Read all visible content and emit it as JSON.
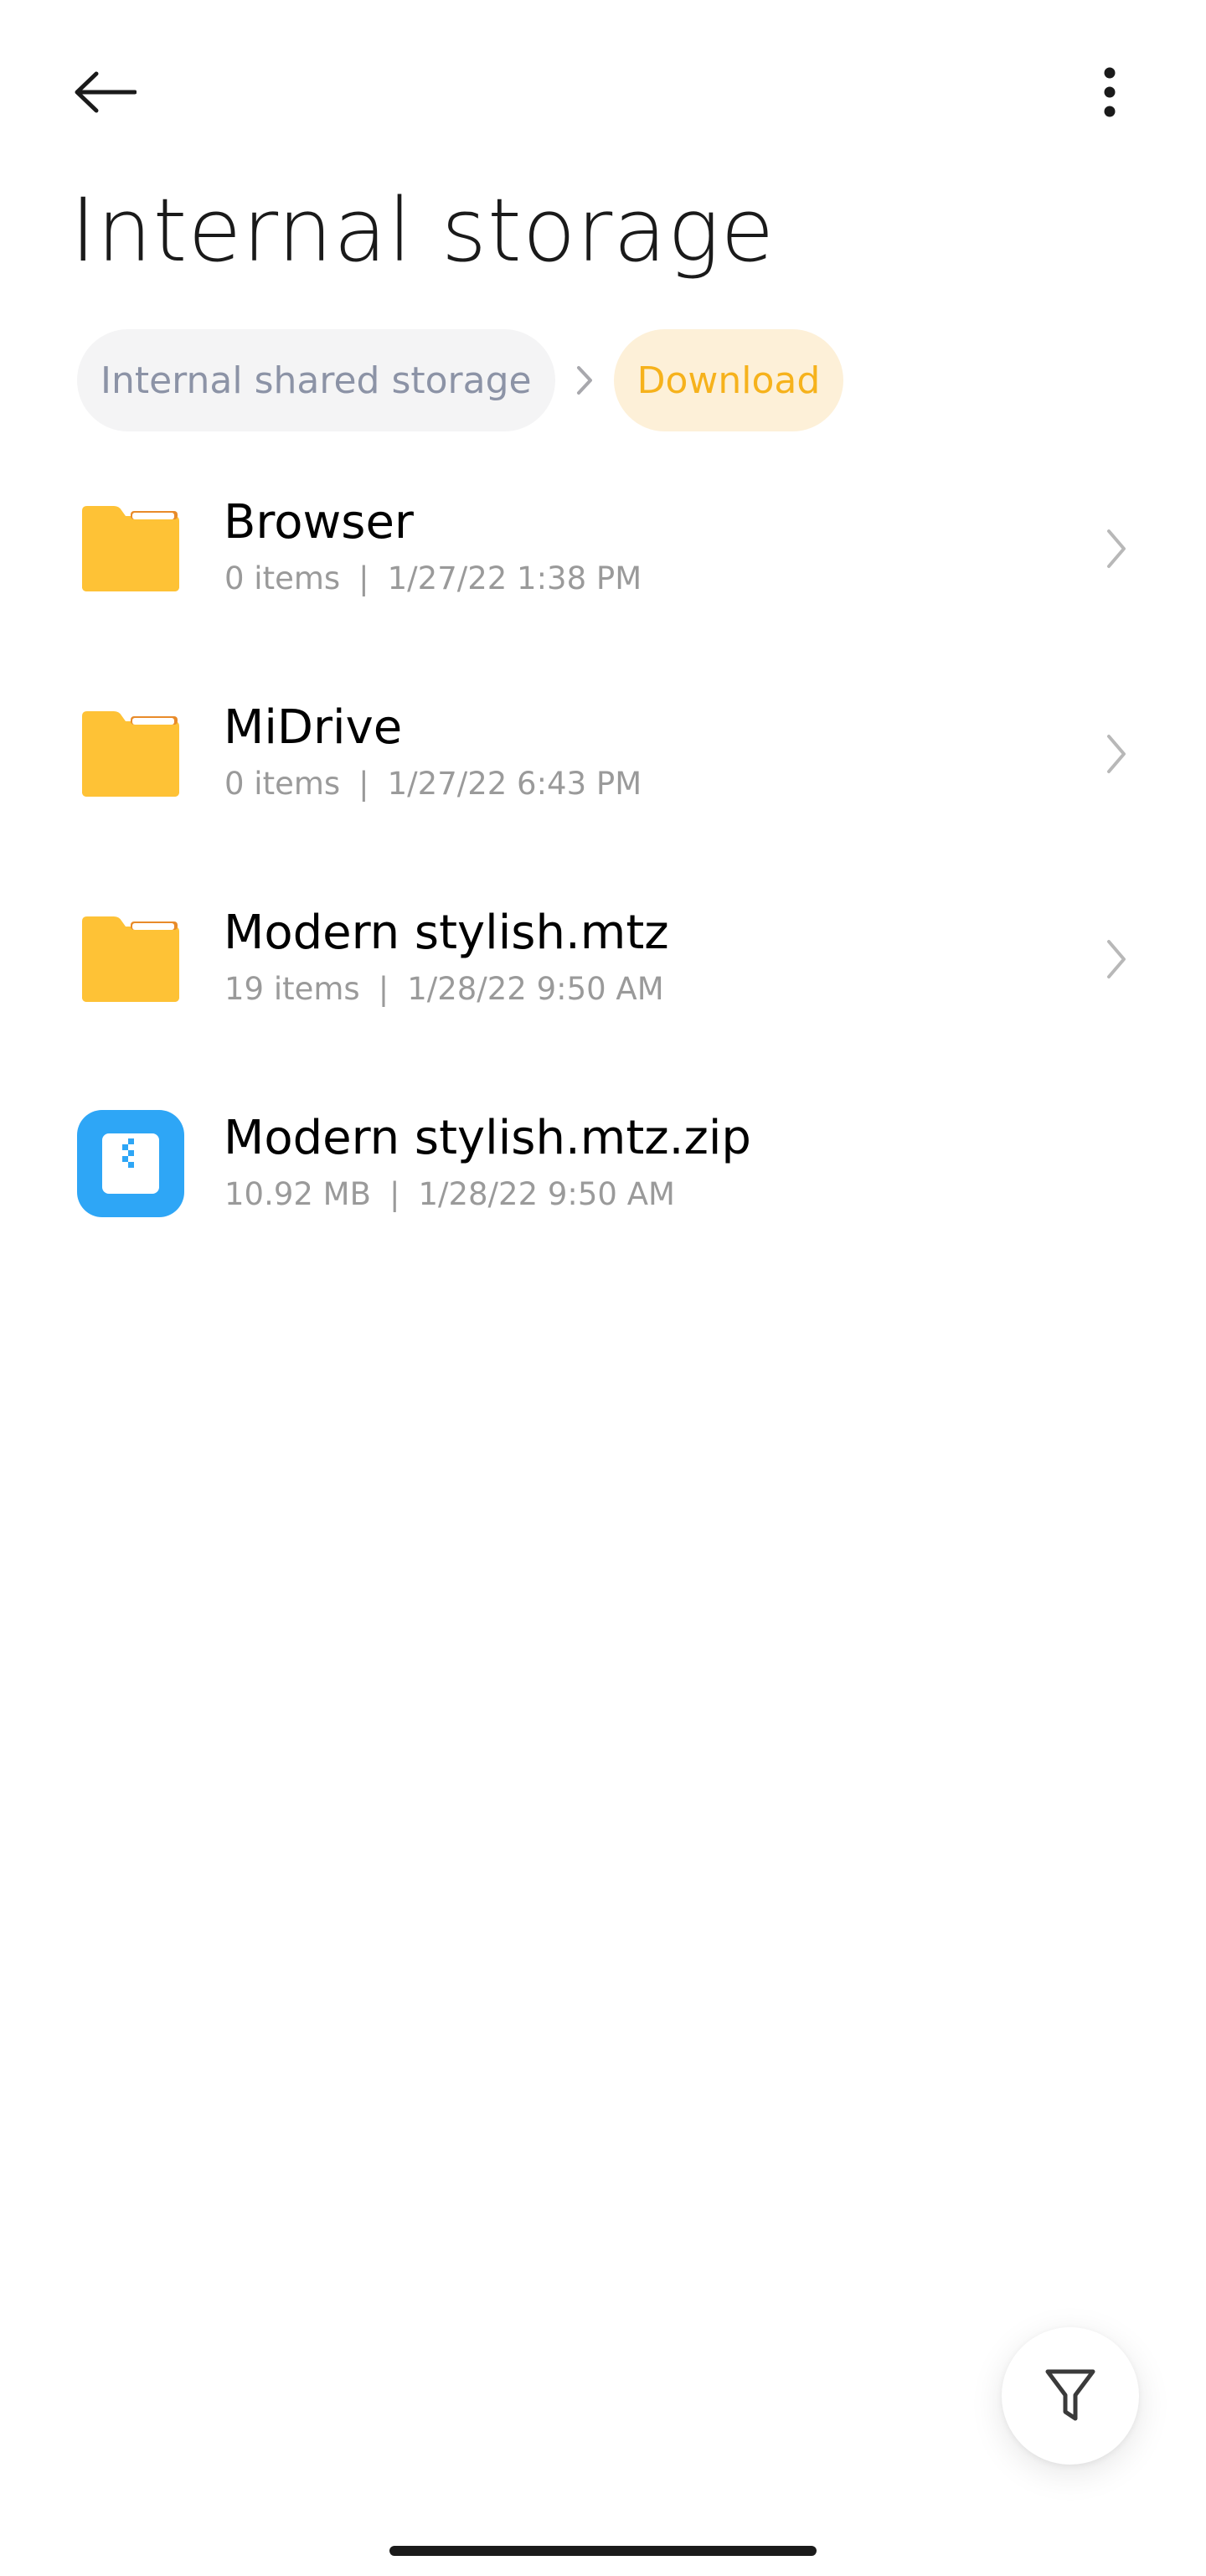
{
  "header": {
    "title": "Internal storage",
    "back_icon": "arrow-left-icon",
    "more_icon": "more-vertical-icon"
  },
  "breadcrumb": {
    "items": [
      {
        "label": "Internal shared storage"
      },
      {
        "label": "Download"
      }
    ],
    "separator_icon": "chevron-right-icon"
  },
  "files": [
    {
      "name": "Browser",
      "count": "0 items",
      "date": "1/27/22 1:38 PM",
      "icon": "folder-icon"
    },
    {
      "name": "MiDrive",
      "count": "0 items",
      "date": "1/27/22 6:43 PM",
      "icon": "folder-icon"
    },
    {
      "name": "Modern stylish.mtz",
      "count": "19 items",
      "date": "1/28/22 9:50 AM",
      "icon": "folder-icon"
    },
    {
      "name": "Modern stylish.mtz.zip",
      "count": "10.92 MB",
      "date": "1/28/22 9:50 AM",
      "icon": "zip-archive-icon"
    }
  ],
  "meta_separator": "|",
  "fab": {
    "icon": "filter-icon"
  },
  "colors": {
    "accent": "#f6b21c",
    "folder": "#fec236",
    "zip": "#2ea6f6",
    "muted_text": "#9a9a9a"
  }
}
